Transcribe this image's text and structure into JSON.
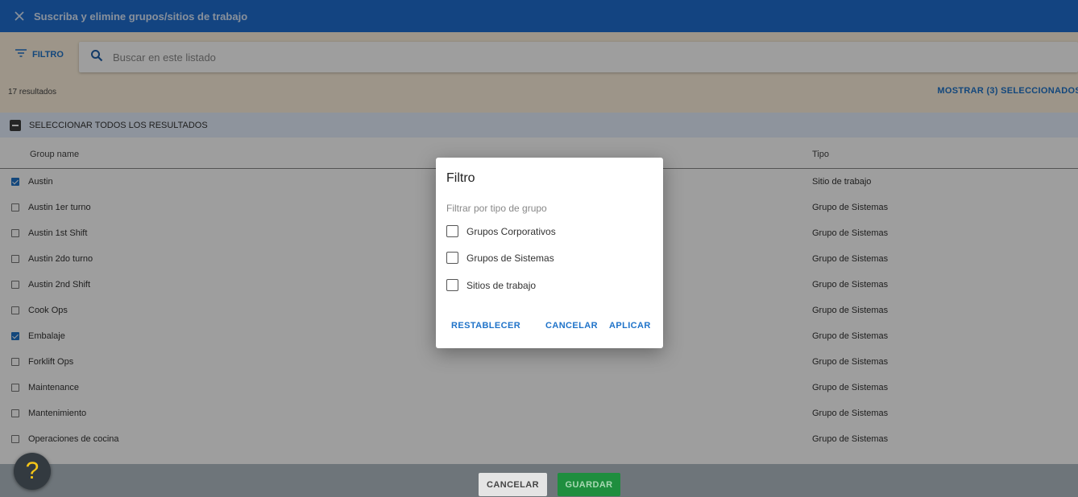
{
  "header": {
    "title": "Suscriba y elimine grupos/sitios de trabajo"
  },
  "filterbar": {
    "filter_label": "FILTRO",
    "search_placeholder": "Buscar en este listado",
    "results": "17 resultados",
    "show_selected": "MOSTRAR (3) SELECCIONADOS"
  },
  "select_all": {
    "label": "SELECCIONAR TODOS LOS RESULTADOS"
  },
  "table": {
    "columns": [
      "Group name",
      "Tipo"
    ],
    "rows": [
      {
        "name": "Austin",
        "tipo": "Sitio de trabajo",
        "checked": true
      },
      {
        "name": "Austin 1er turno",
        "tipo": "Grupo de Sistemas",
        "checked": false
      },
      {
        "name": "Austin 1st Shift",
        "tipo": "Grupo de Sistemas",
        "checked": false
      },
      {
        "name": "Austin 2do turno",
        "tipo": "Grupo de Sistemas",
        "checked": false
      },
      {
        "name": "Austin 2nd Shift",
        "tipo": "Grupo de Sistemas",
        "checked": false
      },
      {
        "name": "Cook Ops",
        "tipo": "Grupo de Sistemas",
        "checked": false
      },
      {
        "name": "Embalaje",
        "tipo": "Grupo de Sistemas",
        "checked": true
      },
      {
        "name": "Forklift Ops",
        "tipo": "Grupo de Sistemas",
        "checked": false
      },
      {
        "name": "Maintenance",
        "tipo": "Grupo de Sistemas",
        "checked": false
      },
      {
        "name": "Mantenimiento",
        "tipo": "Grupo de Sistemas",
        "checked": false
      },
      {
        "name": "Operaciones de cocina",
        "tipo": "Grupo de Sistemas",
        "checked": false
      }
    ]
  },
  "footer": {
    "cancel": "CANCELAR",
    "save": "GUARDAR",
    "help": "?"
  },
  "dialog": {
    "title": "Filtro",
    "subtitle": "Filtrar por tipo de grupo",
    "options": [
      "Grupos Corporativos",
      "Grupos de Sistemas",
      "Sitios de trabajo"
    ],
    "reset": "RESTABLECER",
    "cancel": "CANCELAR",
    "apply": "APLICAR"
  },
  "colors": {
    "header": "#1f6fd1",
    "accent": "#1f73c9",
    "filterbar": "#fdf1dd",
    "save": "#1e8e3e"
  }
}
